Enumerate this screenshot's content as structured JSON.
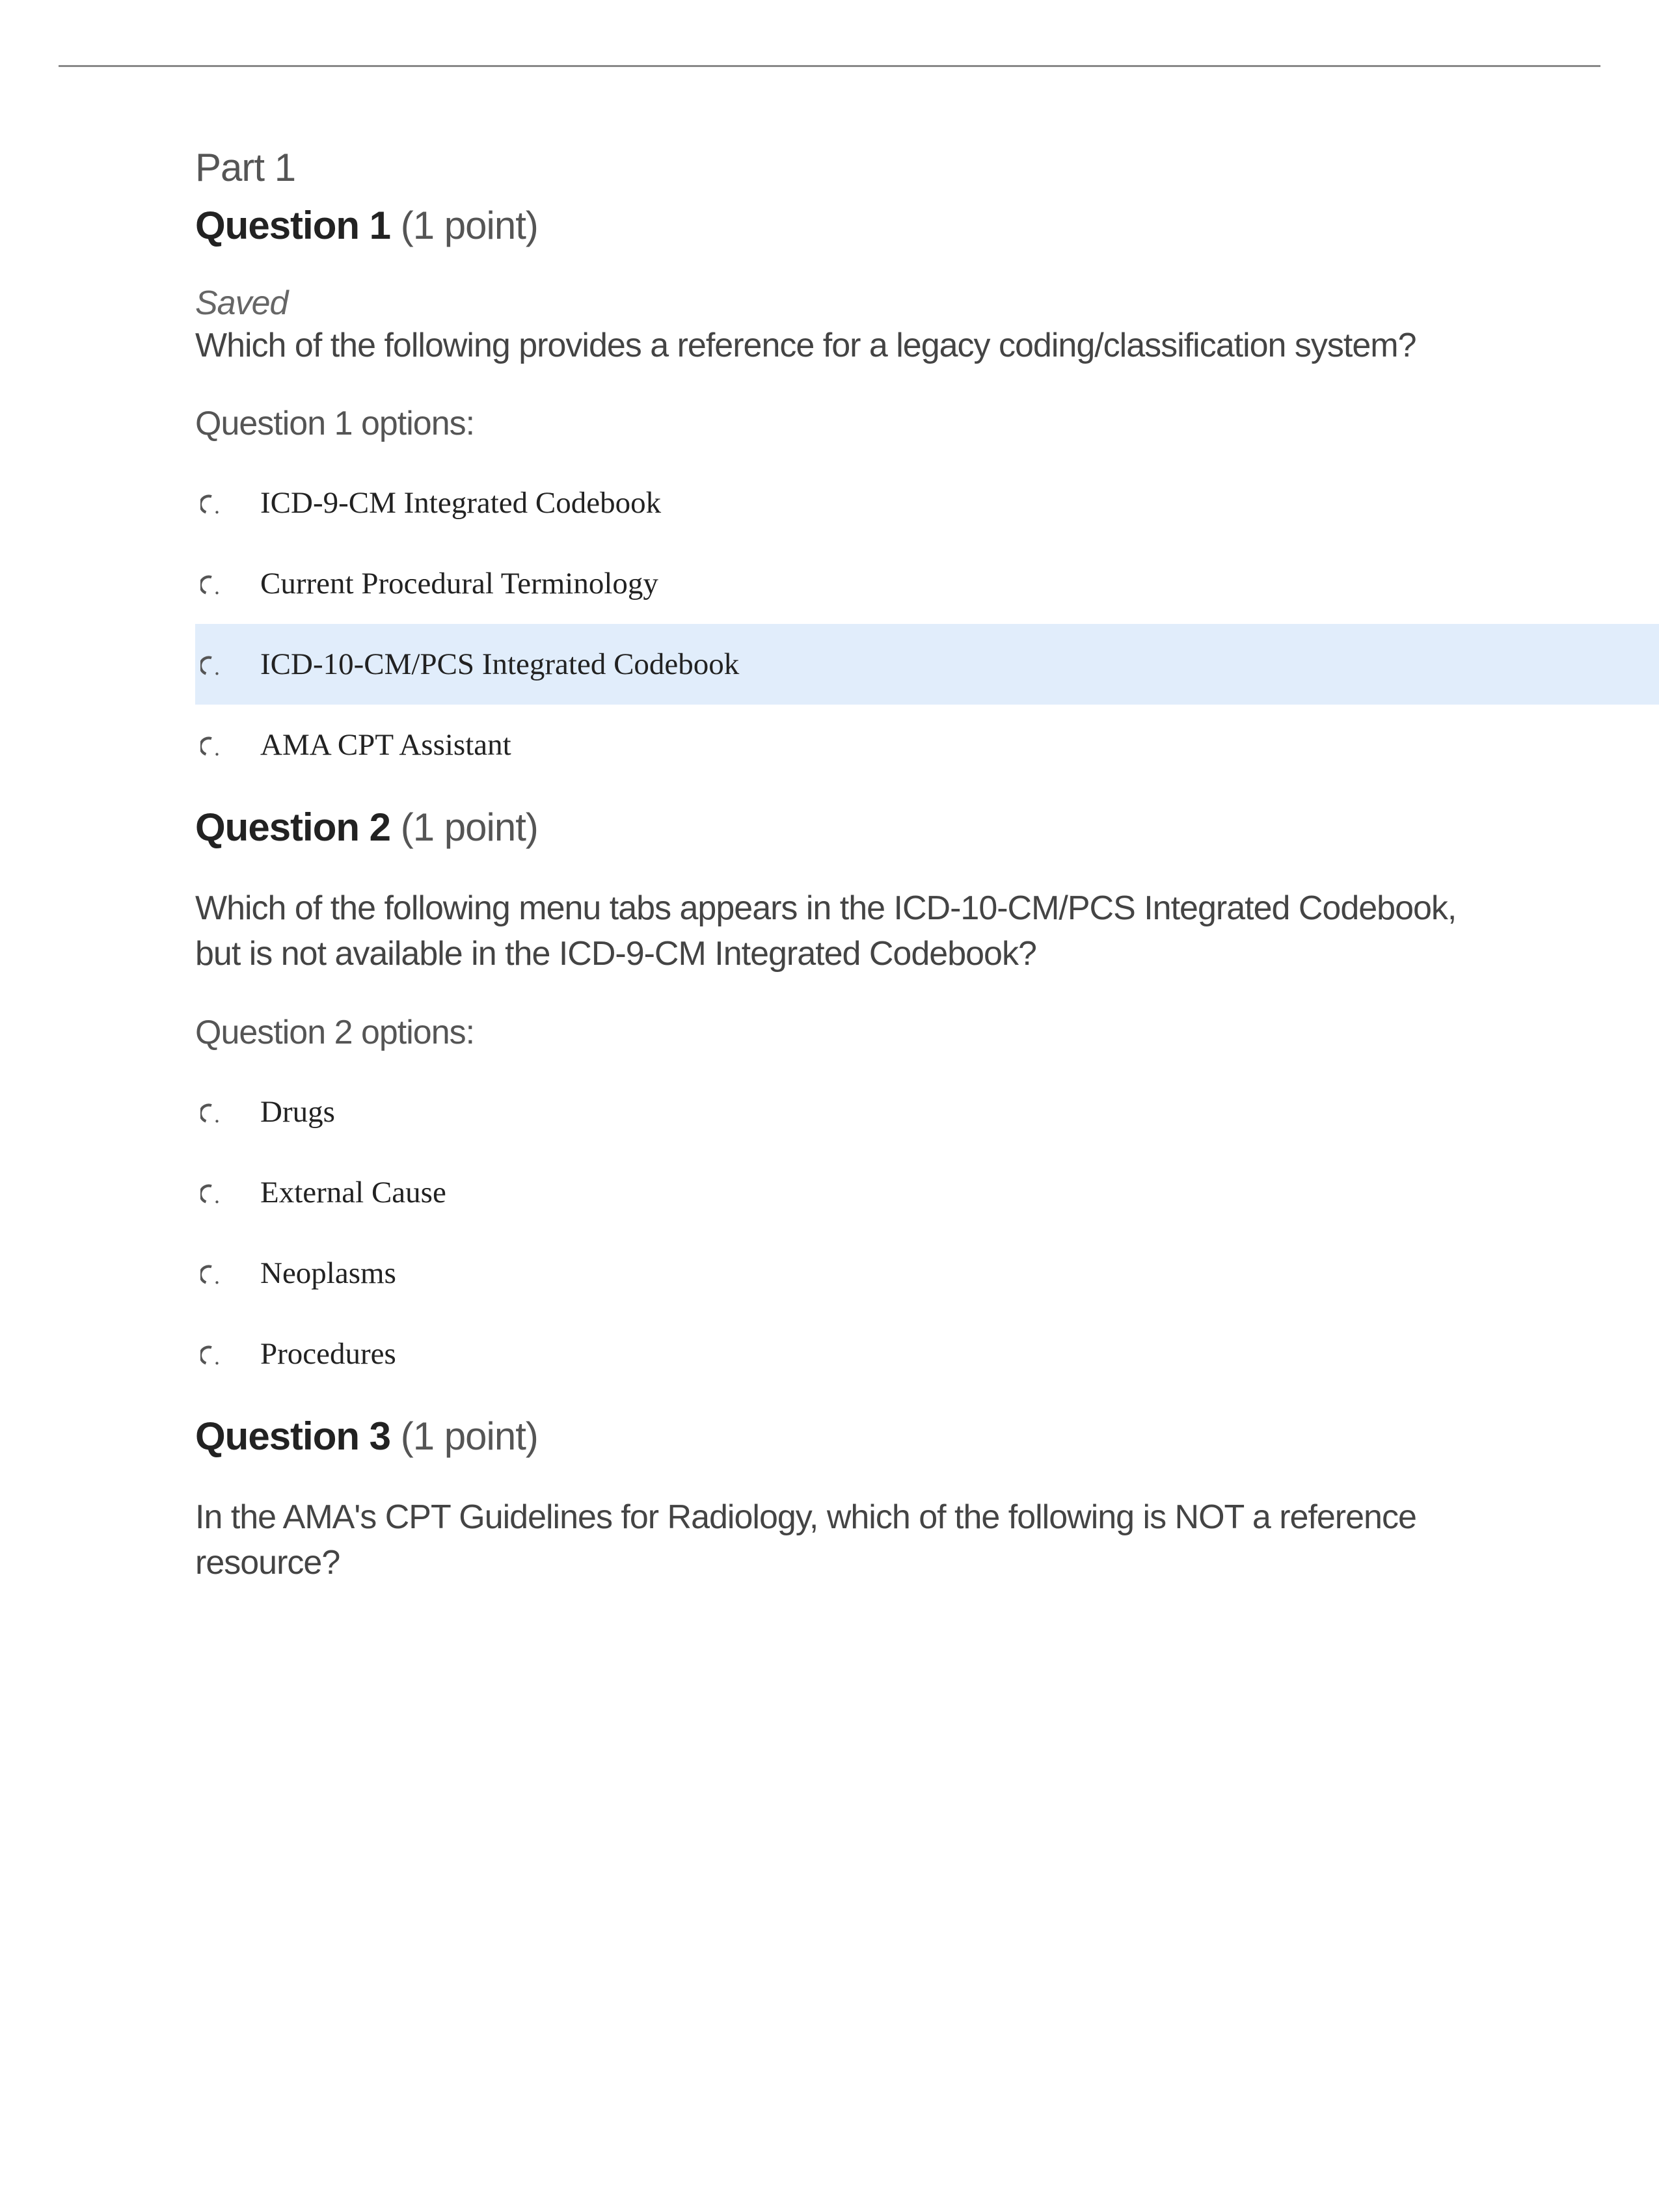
{
  "part_label": "Part 1",
  "questions": [
    {
      "number": "1",
      "heading_bold": "Question 1",
      "points_label": "(1 point)",
      "saved_label": "Saved",
      "text": "Which of the following provides a reference for a legacy coding/classification system?",
      "options_label": "Question 1 options:",
      "selected_index": 2,
      "options": [
        "ICD-9-CM Integrated Codebook",
        "Current Procedural Terminology",
        "ICD-10-CM/PCS Integrated Codebook",
        "AMA CPT Assistant"
      ]
    },
    {
      "number": "2",
      "heading_bold": "Question 2",
      "points_label": "(1 point)",
      "text": "Which of the following menu tabs appears in the ICD-10-CM/PCS Integrated Codebook, but is not available in the ICD-9-CM Integrated Codebook?",
      "options_label": "Question 2 options:",
      "selected_index": -1,
      "options": [
        "Drugs",
        "External Cause",
        "Neoplasms",
        "Procedures"
      ]
    },
    {
      "number": "3",
      "heading_bold": "Question 3",
      "points_label": "(1 point)",
      "text": "In the AMA's CPT Guidelines for Radiology, which of the following is NOT a reference resource?"
    }
  ]
}
